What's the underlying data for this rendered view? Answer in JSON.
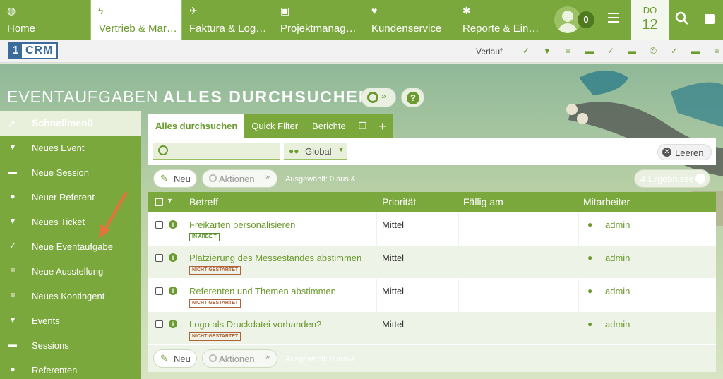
{
  "nav": {
    "tabs": [
      {
        "label": "Home",
        "icon": "globe-icon"
      },
      {
        "label": "Vertrieb & Mar…",
        "icon": "lightning-icon"
      },
      {
        "label": "Faktura & Logis…",
        "icon": "paper-plane-icon"
      },
      {
        "label": "Projektmanage…",
        "icon": "cube-icon"
      },
      {
        "label": "Kundenservice",
        "icon": "heart-icon"
      },
      {
        "label": "Reporte & Eins…",
        "icon": "gear-icon"
      }
    ],
    "notifications": "0",
    "date": {
      "dow": "DO",
      "day": "12"
    }
  },
  "subbar": {
    "logo_number": "1",
    "logo_text": "CRM",
    "history_label": "Verlauf"
  },
  "page": {
    "title_prefix": "EVENTAUFGABEN",
    "title_main": "ALLES DURCHSUCHEN"
  },
  "sidebar": {
    "header": "Schnellmenü",
    "items": [
      {
        "label": "Neues Event",
        "icon": "pizza-icon"
      },
      {
        "label": "Neue Session",
        "icon": "session-icon"
      },
      {
        "label": "Neuer Referent",
        "icon": "user-icon"
      },
      {
        "label": "Neues Ticket",
        "icon": "pizza-icon"
      },
      {
        "label": "Neue Eventaufgabe",
        "icon": "check-circle-icon"
      },
      {
        "label": "Neue Ausstellung",
        "icon": "list-icon"
      },
      {
        "label": "Neues Kontingent",
        "icon": "list-icon"
      },
      {
        "label": "Events",
        "icon": "pizza-icon"
      },
      {
        "label": "Sessions",
        "icon": "session-icon"
      },
      {
        "label": "Referenten",
        "icon": "user-icon"
      }
    ]
  },
  "tabs": {
    "search_all": "Alles durchsuchen",
    "quick_filter": "Quick Filter",
    "reports": "Berichte"
  },
  "filter": {
    "search_placeholder": "",
    "scope": "Global",
    "clear": "Leeren"
  },
  "actions": {
    "new": "Neu",
    "actions": "Aktionen",
    "selected": "Ausgewählt: 0 aus 4",
    "results": "4 Ergebnisse"
  },
  "table": {
    "columns": [
      "Betreff",
      "Priorität",
      "Fällig am",
      "Mitarbeiter"
    ],
    "rows": [
      {
        "subject": "Freikarten personalisieren",
        "status": "IN ARBEIT",
        "status_kind": "progress",
        "priority": "Mittel",
        "due": "",
        "user": "admin"
      },
      {
        "subject": "Platzierung des Messestandes abstimmen",
        "status": "NICHT GESTARTET",
        "status_kind": "notstarted",
        "priority": "Mittel",
        "due": "",
        "user": "admin"
      },
      {
        "subject": "Referenten und Themen abstimmen",
        "status": "NICHT GESTARTET",
        "status_kind": "notstarted",
        "priority": "Mittel",
        "due": "",
        "user": "admin"
      },
      {
        "subject": "Logo als Druckdatei vorhanden?",
        "status": "NICHT GESTARTET",
        "status_kind": "notstarted",
        "priority": "Mittel",
        "due": "",
        "user": "admin"
      }
    ]
  },
  "colors": {
    "accent": "#7aa83c",
    "accent_dark": "#6b9a2e",
    "status_progress": "#5a8e2a",
    "status_notstarted": "#b0623a"
  }
}
